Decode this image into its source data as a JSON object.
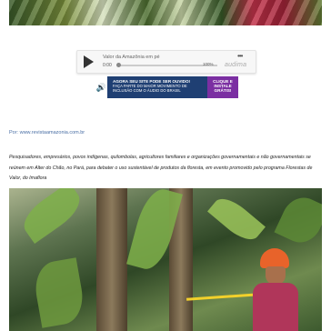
{
  "audio_player": {
    "track_title": "Valor da Amazônia em pé",
    "time": "0:00",
    "volume": "100%",
    "more_label": "•••",
    "brand": "audima"
  },
  "promo_banner": {
    "line1": "Agora seu site pode ser ouvido!",
    "line2": "Faça parte do maior movimento de",
    "line3": "inclusão com o áudio do Brasil",
    "cta": "Clique e instale grátis!"
  },
  "source": "Por: www.revistaamazonia.com.br",
  "caption": "Pesquisadores, empresários, povos indígenas, quilombolas, agricultores familiares e organizações governamentais e não governamentais se reúnem em Alter do Chão, no Pará, para debater o uso sustentável de produtos da floresta, em evento promovido pelo programa Florestas de Valor, do Imaflora",
  "colors": {
    "banner_bg": "#1f3f73",
    "banner_cta": "#7b2fa2",
    "link": "#4a6fa5"
  },
  "icons": {
    "play": "play-icon",
    "speaker": "speaker-icon",
    "more": "more-icon"
  }
}
